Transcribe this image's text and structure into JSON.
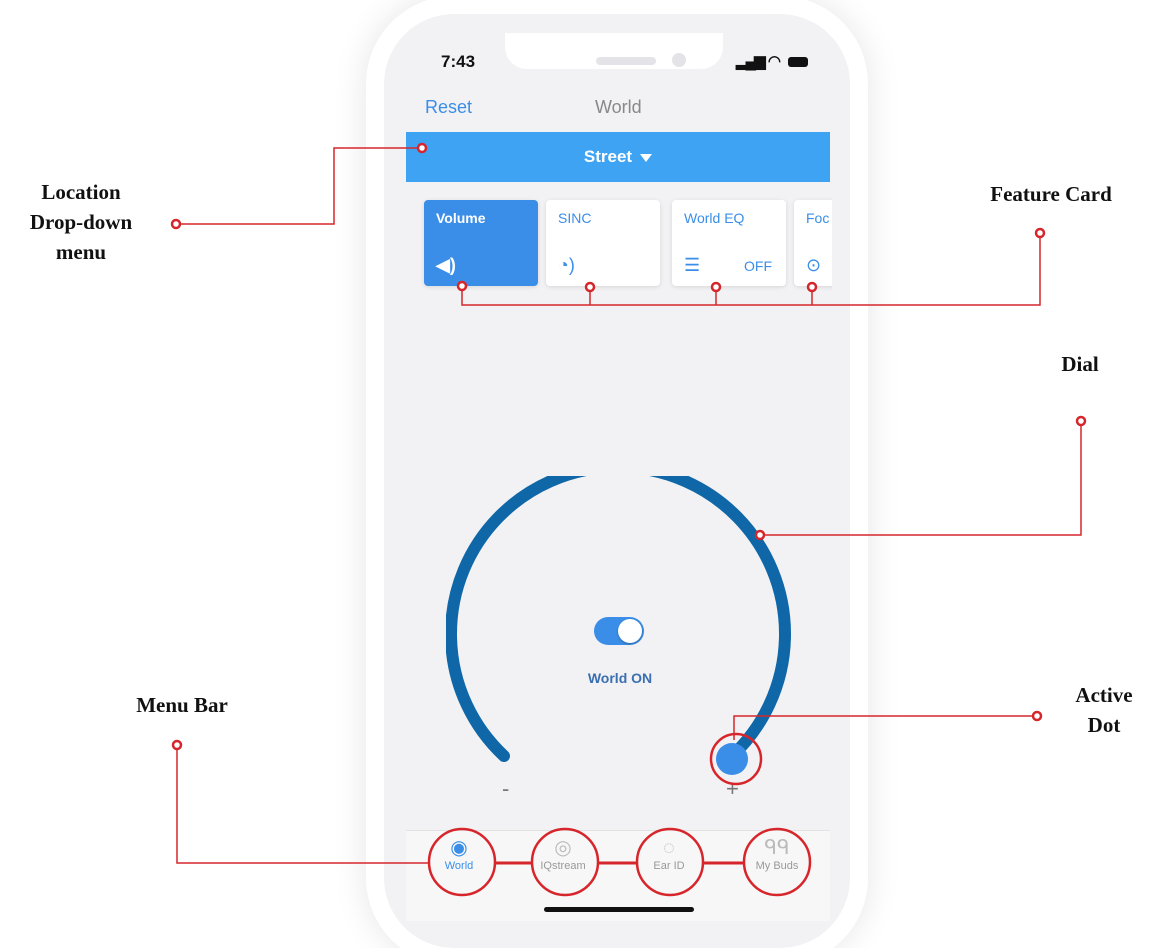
{
  "annotations": {
    "location_dropdown": [
      "Location",
      "Drop-down",
      "menu"
    ],
    "feature_card": "Feature Card",
    "dial": "Dial",
    "menu_bar": "Menu Bar",
    "active_dot": [
      "Active",
      "Dot"
    ],
    "marker_color": "#d7262b"
  },
  "status_bar": {
    "time": "7:43"
  },
  "nav": {
    "left_action": "Reset",
    "title": "World"
  },
  "location": {
    "selected": "Street"
  },
  "feature_cards": [
    {
      "label": "Volume",
      "icon": "speaker-icon",
      "status": "",
      "active": true
    },
    {
      "label": "SINC",
      "icon": "sinc-icon",
      "status": "",
      "active": false
    },
    {
      "label": "World EQ",
      "icon": "sliders-icon",
      "status": "OFF",
      "active": false
    },
    {
      "label": "Foc",
      "icon": "focus-icon",
      "status": "",
      "active": false
    }
  ],
  "dial": {
    "toggle_state": "on",
    "status_label": "World ON",
    "min_label": "-",
    "max_label": "+",
    "level": 1.0,
    "accent": "#0f67a8",
    "dot_color": "#3a8ee8"
  },
  "menu_bar": {
    "tabs": [
      {
        "label": "World",
        "icon": "globe-icon",
        "active": true
      },
      {
        "label": "IQstream",
        "icon": "iqstream-icon",
        "active": false
      },
      {
        "label": "Ear ID",
        "icon": "ear-id-icon",
        "active": false
      },
      {
        "label": "My Buds",
        "icon": "earbuds-icon",
        "active": false
      }
    ]
  }
}
